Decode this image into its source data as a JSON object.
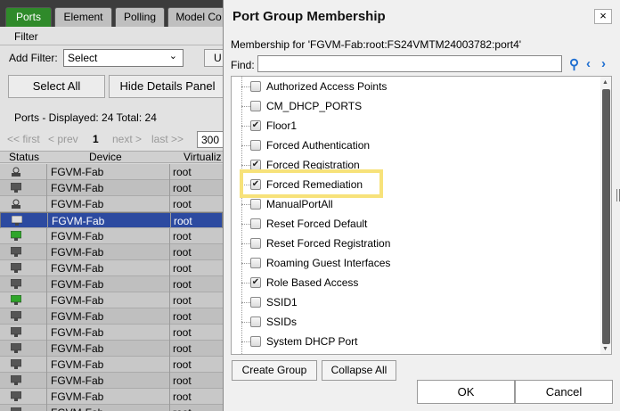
{
  "background": {
    "tabs": [
      "Ports",
      "Element",
      "Polling",
      "Model Co"
    ],
    "filter_label": "Filter",
    "add_filter_label": "Add Filter:",
    "add_filter_value": "Select",
    "update_btn": "U",
    "select_all": "Select All",
    "hide_details": "Hide Details Panel",
    "displayed": "Ports - Displayed: 24 Total: 24",
    "pager": {
      "first": "<< first",
      "prev": "< prev",
      "page": "1",
      "next": "next >",
      "last": "last >>",
      "per_page": "300"
    },
    "columns": [
      "Status",
      "Device",
      "Virtualiz"
    ],
    "rows": [
      {
        "device": "FGVM-Fab",
        "vdom": "root"
      },
      {
        "device": "FGVM-Fab",
        "vdom": "root"
      },
      {
        "device": "FGVM-Fab",
        "vdom": "root"
      },
      {
        "device": "FGVM-Fab",
        "vdom": "root"
      },
      {
        "device": "FGVM-Fab",
        "vdom": "root"
      },
      {
        "device": "FGVM-Fab",
        "vdom": "root"
      },
      {
        "device": "FGVM-Fab",
        "vdom": "root"
      },
      {
        "device": "FGVM-Fab",
        "vdom": "root"
      },
      {
        "device": "FGVM-Fab",
        "vdom": "root"
      },
      {
        "device": "FGVM-Fab",
        "vdom": "root"
      },
      {
        "device": "FGVM-Fab",
        "vdom": "root"
      },
      {
        "device": "FGVM-Fab",
        "vdom": "root"
      },
      {
        "device": "FGVM-Fab",
        "vdom": "root"
      },
      {
        "device": "FGVM-Fab",
        "vdom": "root"
      },
      {
        "device": "FGVM-Fab",
        "vdom": "root"
      },
      {
        "device": "FGVM-Fab",
        "vdom": "root"
      }
    ]
  },
  "dialog": {
    "title": "Port Group Membership",
    "close": "×",
    "membership_for": "Membership for 'FGVM-Fab:root:FS24VMTM24003782:port4'",
    "find_label": "Find:",
    "find_value": "",
    "groups": [
      {
        "label": "Authorized Access Points",
        "checked": false
      },
      {
        "label": "CM_DHCP_PORTS",
        "checked": false
      },
      {
        "label": "Floor1",
        "checked": true
      },
      {
        "label": "Forced Authentication",
        "checked": false
      },
      {
        "label": "Forced Registration",
        "checked": true
      },
      {
        "label": "Forced Remediation",
        "checked": true
      },
      {
        "label": "ManualPortAll",
        "checked": false
      },
      {
        "label": "Reset Forced Default",
        "checked": false
      },
      {
        "label": "Reset Forced Registration",
        "checked": false
      },
      {
        "label": "Roaming Guest Interfaces",
        "checked": false
      },
      {
        "label": "Role Based Access",
        "checked": true
      },
      {
        "label": "SSID1",
        "checked": false
      },
      {
        "label": "SSIDs",
        "checked": false
      },
      {
        "label": "System DHCP Port",
        "checked": false
      }
    ],
    "create_group": "Create Group",
    "collapse_all": "Collapse All",
    "ok": "OK",
    "cancel": "Cancel"
  },
  "colors": {
    "active_tab": "#2f8a2a",
    "selected_row": "#2c4aa0",
    "highlight": "#f7e27a",
    "icon_blue": "#1f6fd1"
  }
}
